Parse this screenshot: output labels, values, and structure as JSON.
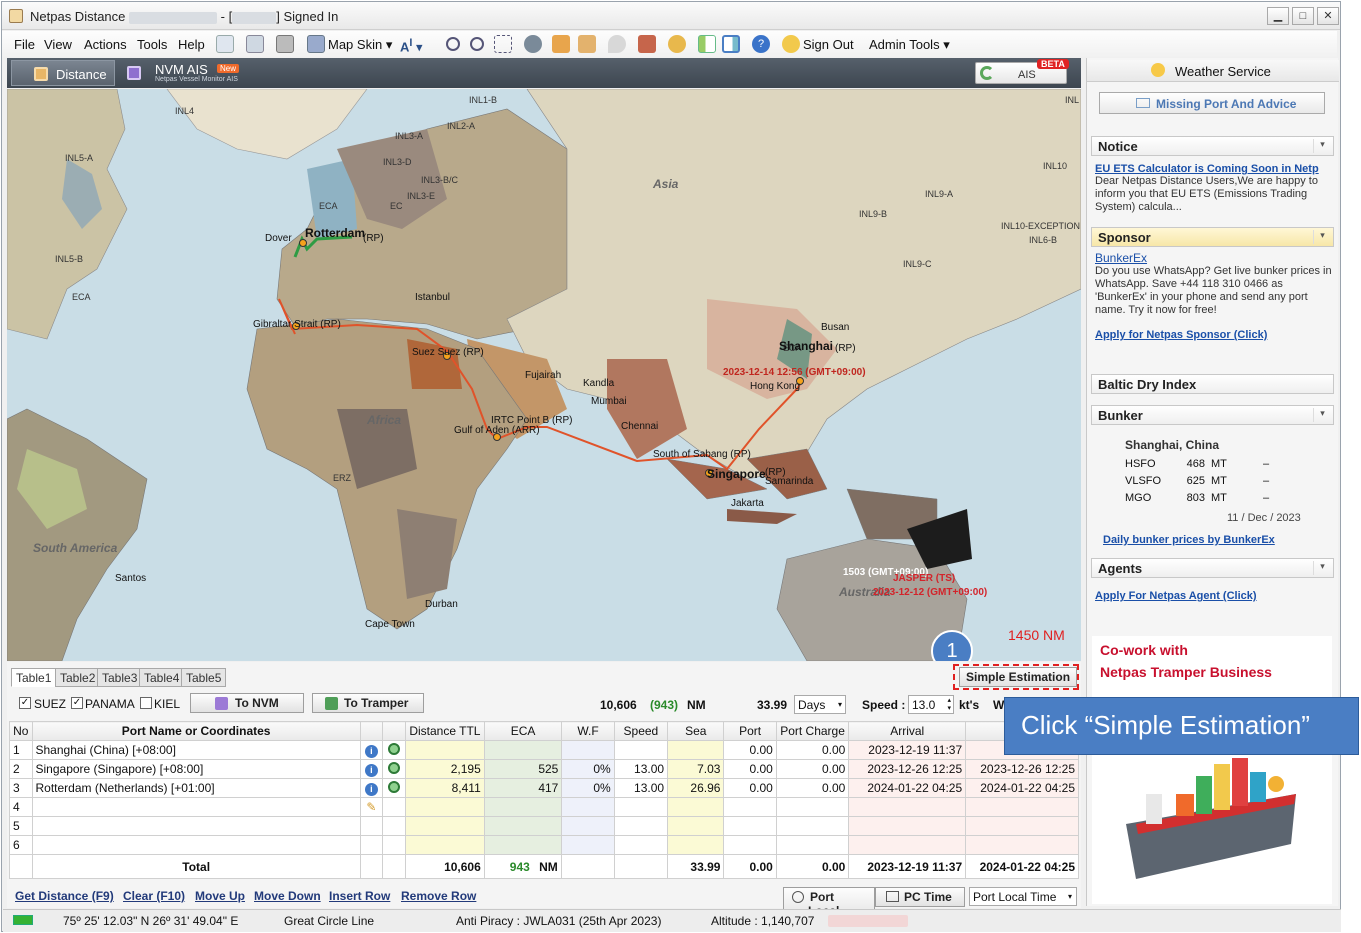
{
  "window": {
    "title": "Netpas Distance",
    "signed_in": "Signed In",
    "sep": "-  [",
    "bracket": "]"
  },
  "menu": {
    "file": "File",
    "view": "View",
    "actions": "Actions",
    "tools": "Tools",
    "help": "Help",
    "map_skin": "Map Skin",
    "sign_out": "Sign Out",
    "admin_tools": "Admin Tools"
  },
  "nav": {
    "distance_tab": "Distance",
    "nvm_ais": "NVM AIS",
    "nvm_new": "New",
    "nvm_sub": "Netpas Vessel Monitor AIS",
    "ais": "AIS",
    "beta": "BETA"
  },
  "map": {
    "regions": [
      "INL1-B",
      "INL2-A",
      "INL3-A",
      "INL3-D",
      "INL3-B/C",
      "INL3-E",
      "INL4",
      "INL5-A",
      "INL5-B",
      "ECA",
      "ECA",
      "EC",
      "ECA",
      "INL10",
      "INL9-A",
      "INL9-B",
      "INL10-EXCEPTION",
      "INL6-B",
      "INL9-C",
      "ERZ",
      "INL"
    ],
    "continents": {
      "asia": "Asia",
      "africa": "Africa",
      "south_america": "South America",
      "australia": "Australia"
    },
    "ports": {
      "rotterdam": "Rotterdam",
      "dover": "Dover",
      "rp": "(RP)",
      "istanbul": "Istanbul",
      "gibraltar": "Gibraltar Strait (RP)",
      "suez": "Suez Suez (RP)",
      "fujairah": "Fujairah",
      "kandla": "Kandla",
      "mumbai": "Mumbai",
      "irtc": "IRTC Point B (RP)",
      "gulf_aden": "Gulf of Aden (ARR)",
      "chennai": "Chennai",
      "sabang": "South of Sabang (RP)",
      "singapore": "Singapore",
      "sing_rp": "(RP)",
      "samarinda": "Samarinda",
      "jakarta": "Jakarta",
      "busan": "Busan",
      "shanghai": "Shanghai",
      "sh_rp": "(RP)",
      "hong_kong": "Hong Kong",
      "ship_time": "2023-12-14 12:56 (GMT+09:00)",
      "durban": "Durban",
      "santos": "Santos",
      "cape_town": "Cape Town",
      "v1": "1503 (GMT+09:00)",
      "jasper": "JASPER (TS)",
      "v2": "2023-12-12 (GMT+09:00)"
    },
    "annotation_nm": "1450 NM",
    "annotation_step": "1"
  },
  "bottom": {
    "tabs": [
      "Table1",
      "Table2",
      "Table3",
      "Table4",
      "Table5"
    ],
    "simple_estimation": "Simple Estimation",
    "suez": "SUEZ",
    "panama": "PANAMA",
    "kiel": "KIEL",
    "to_nvm": "To NVM",
    "to_tramper": "To Tramper",
    "total_dist": "10,606",
    "eca_dist": "(943)",
    "nm": "NM",
    "days_val": "33.99",
    "days_unit": "Days",
    "speed_label": "Speed :",
    "speed_val": "13.0",
    "speed_unit": "kt's",
    "w_label": "W",
    "headers": [
      "No",
      "Port Name or Coordinates",
      "",
      "",
      "Distance TTL",
      "ECA",
      "W.F",
      "Speed",
      "Sea",
      "Port",
      "Port Charge",
      "Arrival",
      "De"
    ],
    "rows": [
      {
        "no": "1",
        "port": "Shanghai (China) [+08:00]",
        "dist": "",
        "eca": "",
        "wf": "",
        "speed": "",
        "sea": "",
        "port_d": "0.00",
        "charge": "0.00",
        "arrival": "2023-12-19 11:37",
        "dep": "2023-12"
      },
      {
        "no": "2",
        "port": "Singapore (Singapore) [+08:00]",
        "dist": "2,195",
        "eca": "525",
        "wf": "0%",
        "speed": "13.00",
        "sea": "7.03",
        "port_d": "0.00",
        "charge": "0.00",
        "arrival": "2023-12-26 12:25",
        "dep": "2023-12-26 12:25"
      },
      {
        "no": "3",
        "port": "Rotterdam (Netherlands) [+01:00]",
        "dist": "8,411",
        "eca": "417",
        "wf": "0%",
        "speed": "13.00",
        "sea": "26.96",
        "port_d": "0.00",
        "charge": "0.00",
        "arrival": "2024-01-22 04:25",
        "dep": "2024-01-22 04:25"
      },
      {
        "no": "4",
        "port": "",
        "dist": "",
        "eca": "",
        "wf": "",
        "speed": "",
        "sea": "",
        "port_d": "",
        "charge": "",
        "arrival": "",
        "dep": ""
      },
      {
        "no": "5",
        "port": "",
        "dist": "",
        "eca": "",
        "wf": "",
        "speed": "",
        "sea": "",
        "port_d": "",
        "charge": "",
        "arrival": "",
        "dep": ""
      },
      {
        "no": "6",
        "port": "",
        "dist": "",
        "eca": "",
        "wf": "",
        "speed": "",
        "sea": "",
        "port_d": "",
        "charge": "",
        "arrival": "",
        "dep": ""
      }
    ],
    "total": {
      "label": "Total",
      "dist": "10,606",
      "eca": "943",
      "nm": "NM",
      "sea": "33.99",
      "port": "0.00",
      "charge": "0.00",
      "arrival": "2023-12-19 11:37",
      "dep": "2024-01-22 04:25"
    },
    "actions": [
      "Get Distance (F9)",
      "Clear (F10)",
      "Move Up",
      "Move Down",
      "Insert Row",
      "Remove Row"
    ],
    "port_local": "Port Local",
    "pc_time": "PC Time",
    "time_select": "Port Local Time"
  },
  "right": {
    "weather": "Weather Service",
    "missing_port": "Missing Port And Advice",
    "notice": "Notice",
    "notice_link": "EU ETS Calculator is Coming Soon in Netp",
    "notice_text": "Dear Netpas Distance Users,We are happy to inform you that EU ETS (Emissions Trading System) calcula...",
    "sponsor": "Sponsor",
    "sponsor_link": "BunkerEx",
    "sponsor_text": "Do you use WhatsApp? Get live bunker prices in WhatsApp. Save +44 118 310 0466 as 'BunkerEx' in your phone and send any port name. Try it now for free!",
    "sponsor_apply": "Apply for Netpas Sponsor (Click)",
    "baltic": "Baltic Dry Index",
    "bunker": "Bunker",
    "bunker_place": "Shanghai, China",
    "bunker_rows": [
      {
        "fuel": "HSFO",
        "price": "468",
        "unit": "MT",
        "chg": "–"
      },
      {
        "fuel": "VLSFO",
        "price": "625",
        "unit": "MT",
        "chg": "–"
      },
      {
        "fuel": "MGO",
        "price": "803",
        "unit": "MT",
        "chg": "–"
      }
    ],
    "bunker_date": "11 / Dec / 2023",
    "bunker_daily": "Daily bunker prices by BunkerEx",
    "agents": "Agents",
    "agents_apply": "Apply For Netpas Agent (Click)",
    "ad_line1": "Co-work with",
    "ad_line2": "Netpas Tramper Business"
  },
  "callout": "Click “Simple Estimation”",
  "status": {
    "coords": "75º 25' 12.03\" N 26º 31' 49.04\" E",
    "mode": "Great Circle Line",
    "piracy": "Anti Piracy : JWLA031 (25th Apr 2023)",
    "altitude": "Altitude : 1,140,707"
  },
  "colors": {
    "route": "#e0532a",
    "annotation": "#e02020",
    "callout_bg": "#4a7ec4",
    "ad_red": "#c8102e"
  }
}
